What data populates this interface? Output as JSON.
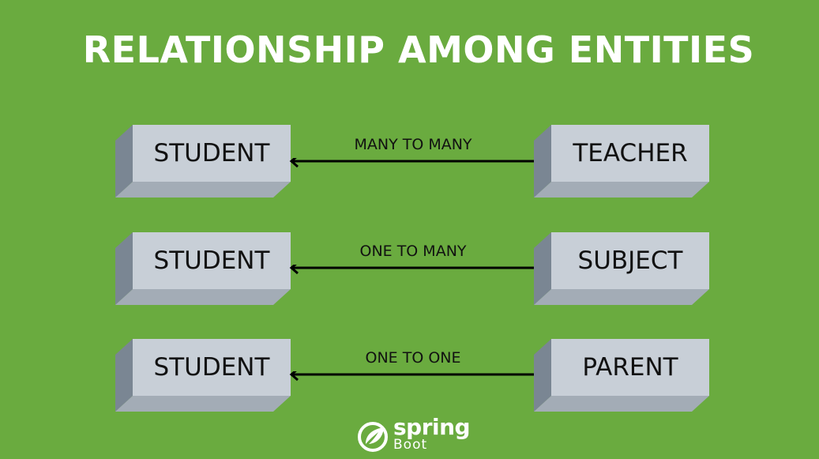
{
  "title": "RELATIONSHIP AMONG ENTITIES",
  "colors": {
    "background": "#6aab3f",
    "box_face": "#c8cfd7",
    "box_side": "#7a8693",
    "box_bottom": "#a3acb6",
    "text": "#111111",
    "title": "#ffffff"
  },
  "relationships": [
    {
      "left": "STUDENT",
      "label": "MANY TO MANY",
      "right": "TEACHER"
    },
    {
      "left": "STUDENT",
      "label": "ONE TO MANY",
      "right": "SUBJECT"
    },
    {
      "left": "STUDENT",
      "label": "ONE TO ONE",
      "right": "PARENT"
    }
  ],
  "logo": {
    "word": "spring",
    "sub": "Boot",
    "icon": "spring-leaf-icon"
  }
}
